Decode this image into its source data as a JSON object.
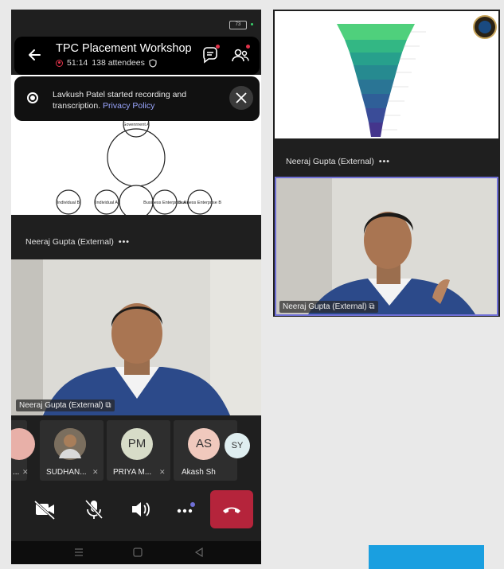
{
  "status_bar": {
    "battery": "73"
  },
  "header": {
    "title": "TPC Placement Workshop",
    "duration": "51:14",
    "attendees": "138 attendees"
  },
  "banner": {
    "message": "Lavkush Patel started recording and transcription.",
    "link": "Privacy Policy"
  },
  "diagram": {
    "labels": [
      "B",
      "Govenrnent A",
      "Individual B",
      "Individual A",
      "Business Enterprise A",
      "Business Enterprise B"
    ]
  },
  "main_stage": {
    "presenter_label": "Neeraj Gupta (External)",
    "video_label": "Neeraj Gupta (External)"
  },
  "participants": [
    {
      "initials": "",
      "name": "...",
      "color": "#e8b0a8"
    },
    {
      "initials": "",
      "name": "SUDHAN...",
      "color": "#8a6a4a"
    },
    {
      "initials": "PM",
      "name": "PRIYA  M...",
      "color": "#d7dcc8"
    },
    {
      "initials": "AS",
      "name": "Akash Sh",
      "color": "#f0c9bd"
    },
    {
      "initials": "SY",
      "name": "",
      "color": "#dfeef0"
    }
  ],
  "right_pane": {
    "presenter_label": "Neeraj Gupta (External)",
    "video_label": "Neeraj Gupta (External)"
  },
  "colors": {
    "accent": "#6f6fd6",
    "leave": "#b5243b",
    "record": "#e0334a",
    "cta": "#1a9fe0"
  }
}
